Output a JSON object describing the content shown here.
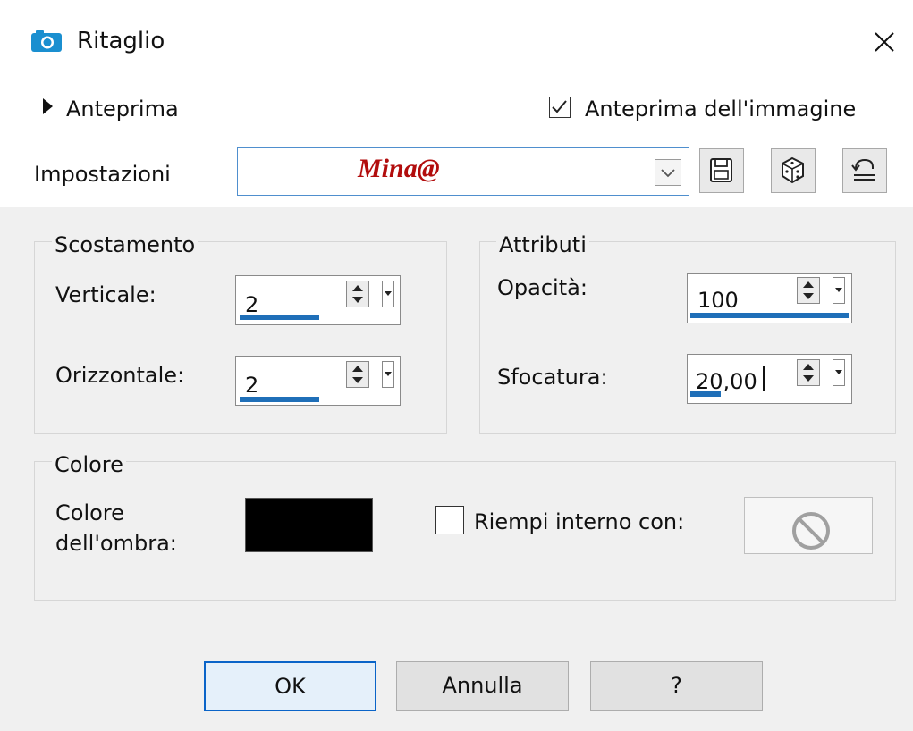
{
  "window": {
    "title": "Ritaglio",
    "icon": "camera-icon",
    "close_icon": "close-icon"
  },
  "preview": {
    "label": "Anteprima",
    "image_preview_label": "Anteprima dell'immagine",
    "image_preview_checked": true
  },
  "settings": {
    "label": "Impostazioni",
    "value": "Mina@",
    "value_color": "#b20d0d",
    "buttons": [
      "save-icon",
      "randomize-icon",
      "reset-icon"
    ]
  },
  "offset": {
    "title": "Scostamento",
    "vertical_label": "Verticale:",
    "vertical_value": "2",
    "horizontal_label": "Orizzontale:",
    "horizontal_value": "2"
  },
  "attributes": {
    "title": "Attributi",
    "opacity_label": "Opacità:",
    "opacity_value": "100",
    "blur_label": "Sfocatura:",
    "blur_value": "20,00"
  },
  "color": {
    "title": "Colore",
    "shadow_label_line1": "Colore",
    "shadow_label_line2": "dell'ombra:",
    "shadow_color": "#000000",
    "fill_label": "Riempi interno con:",
    "fill_checked": false,
    "fill_icon": "no-symbol-icon"
  },
  "buttons": {
    "ok": "OK",
    "cancel": "Annulla",
    "help": "?"
  },
  "accent_color": "#1f6fb8"
}
